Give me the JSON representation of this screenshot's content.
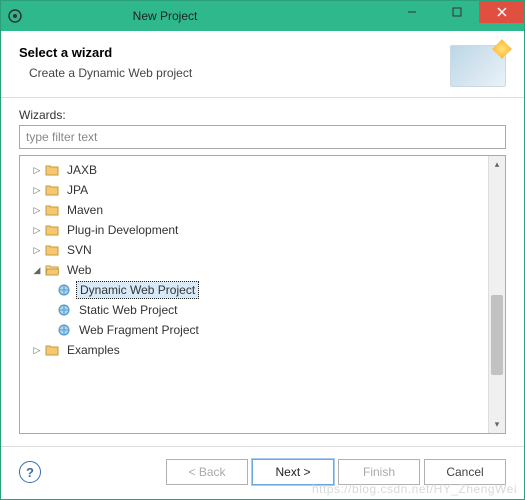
{
  "window": {
    "title": "New Project"
  },
  "header": {
    "title": "Select a wizard",
    "description": "Create a Dynamic Web project"
  },
  "body": {
    "wizards_label": "Wizards:",
    "filter_placeholder": "type filter text"
  },
  "tree": {
    "items": [
      {
        "label": "JAXB",
        "expanded": false
      },
      {
        "label": "JPA",
        "expanded": false
      },
      {
        "label": "Maven",
        "expanded": false
      },
      {
        "label": "Plug-in Development",
        "expanded": false
      },
      {
        "label": "SVN",
        "expanded": false
      },
      {
        "label": "Web",
        "expanded": true,
        "children": [
          {
            "label": "Dynamic Web Project",
            "selected": true
          },
          {
            "label": "Static Web Project"
          },
          {
            "label": "Web Fragment Project"
          }
        ]
      },
      {
        "label": "Examples",
        "expanded": false
      }
    ]
  },
  "footer": {
    "back": "< Back",
    "next": "Next >",
    "finish": "Finish",
    "cancel": "Cancel"
  },
  "watermark": "https://blog.csdn.net/HY_ZhengWei"
}
